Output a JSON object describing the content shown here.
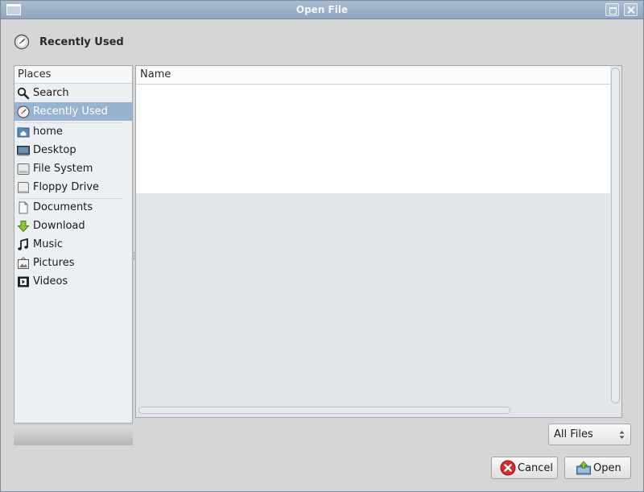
{
  "window": {
    "title": "Open File"
  },
  "location": {
    "label": "Recently Used",
    "icon": "clock-icon"
  },
  "places": {
    "header": "Places",
    "items": [
      {
        "label": "Search",
        "icon": "search-icon"
      },
      {
        "label": "Recently Used",
        "icon": "clock-icon",
        "selected": true
      },
      {
        "label": "home",
        "icon": "home-folder-icon"
      },
      {
        "label": "Desktop",
        "icon": "desktop-icon"
      },
      {
        "label": "File System",
        "icon": "drive-icon"
      },
      {
        "label": "Floppy Drive",
        "icon": "floppy-icon"
      },
      {
        "label": "Documents",
        "icon": "document-icon"
      },
      {
        "label": "Download",
        "icon": "download-arrow-icon"
      },
      {
        "label": "Music",
        "icon": "music-note-icon"
      },
      {
        "label": "Pictures",
        "icon": "picture-icon"
      },
      {
        "label": "Videos",
        "icon": "film-icon"
      }
    ]
  },
  "file_list": {
    "columns": [
      "Name"
    ],
    "rows": []
  },
  "filter": {
    "selected": "All Files"
  },
  "buttons": {
    "cancel": "Cancel",
    "open": "Open"
  },
  "colors": {
    "titlebar": "#9fb3c8",
    "selection": "#97b3cf",
    "window_bg": "#d6d6d6"
  }
}
